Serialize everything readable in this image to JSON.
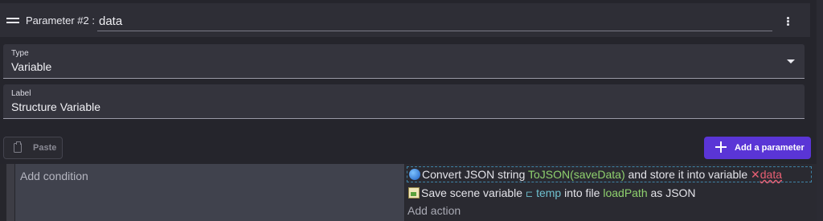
{
  "parameter": {
    "title": "Parameter #2 :",
    "name_value": "data"
  },
  "type_field": {
    "label": "Type",
    "value": "Variable"
  },
  "label_field": {
    "label": "Label",
    "value": "Structure Variable"
  },
  "buttons": {
    "paste": "Paste",
    "add_parameter": "Add a parameter"
  },
  "event": {
    "add_condition": "Add condition",
    "actions": [
      {
        "icon": "globe-icon",
        "prefix": "Convert JSON string",
        "arg1": "ToJSON(saveData)",
        "middle": "and store it into variable",
        "error_mark": "✕",
        "arg2": "data"
      },
      {
        "icon": "file-save-icon",
        "prefix": "Save scene variable",
        "var_icon": "⊏",
        "arg1": "temp",
        "middle": "into file",
        "arg2": "loadPath",
        "suffix": "as JSON"
      }
    ],
    "add_action": "Add action"
  },
  "colors": {
    "accent": "#5a35d6",
    "argument_green": "#8fd16e",
    "variable_teal": "#6fc0cf",
    "error_red": "#e85f73"
  }
}
